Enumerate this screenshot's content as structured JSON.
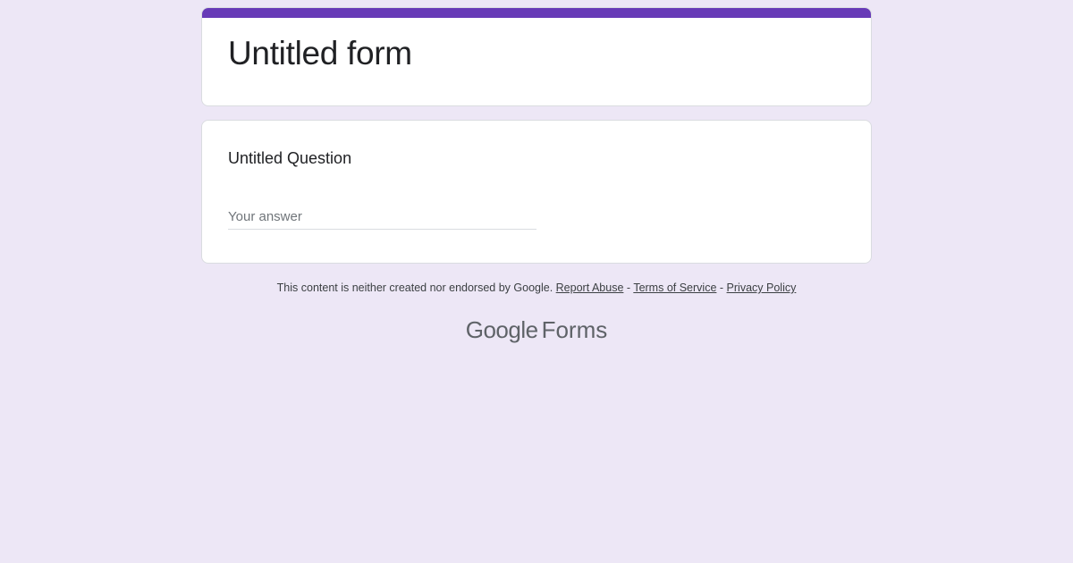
{
  "colors": {
    "background": "#ede7f6",
    "accent": "#673ab7",
    "card": "#ffffff"
  },
  "form": {
    "title": "Untitled form"
  },
  "question": {
    "title": "Untitled Question",
    "answer_placeholder": "Your answer"
  },
  "footer": {
    "disclaimer": "This content is neither created nor endorsed by Google.",
    "report_abuse": "Report Abuse",
    "separator_1": "-",
    "terms": "Terms of Service",
    "separator_2": "-",
    "privacy": "Privacy Policy"
  },
  "brand": {
    "google": "Google",
    "forms": "Forms"
  }
}
